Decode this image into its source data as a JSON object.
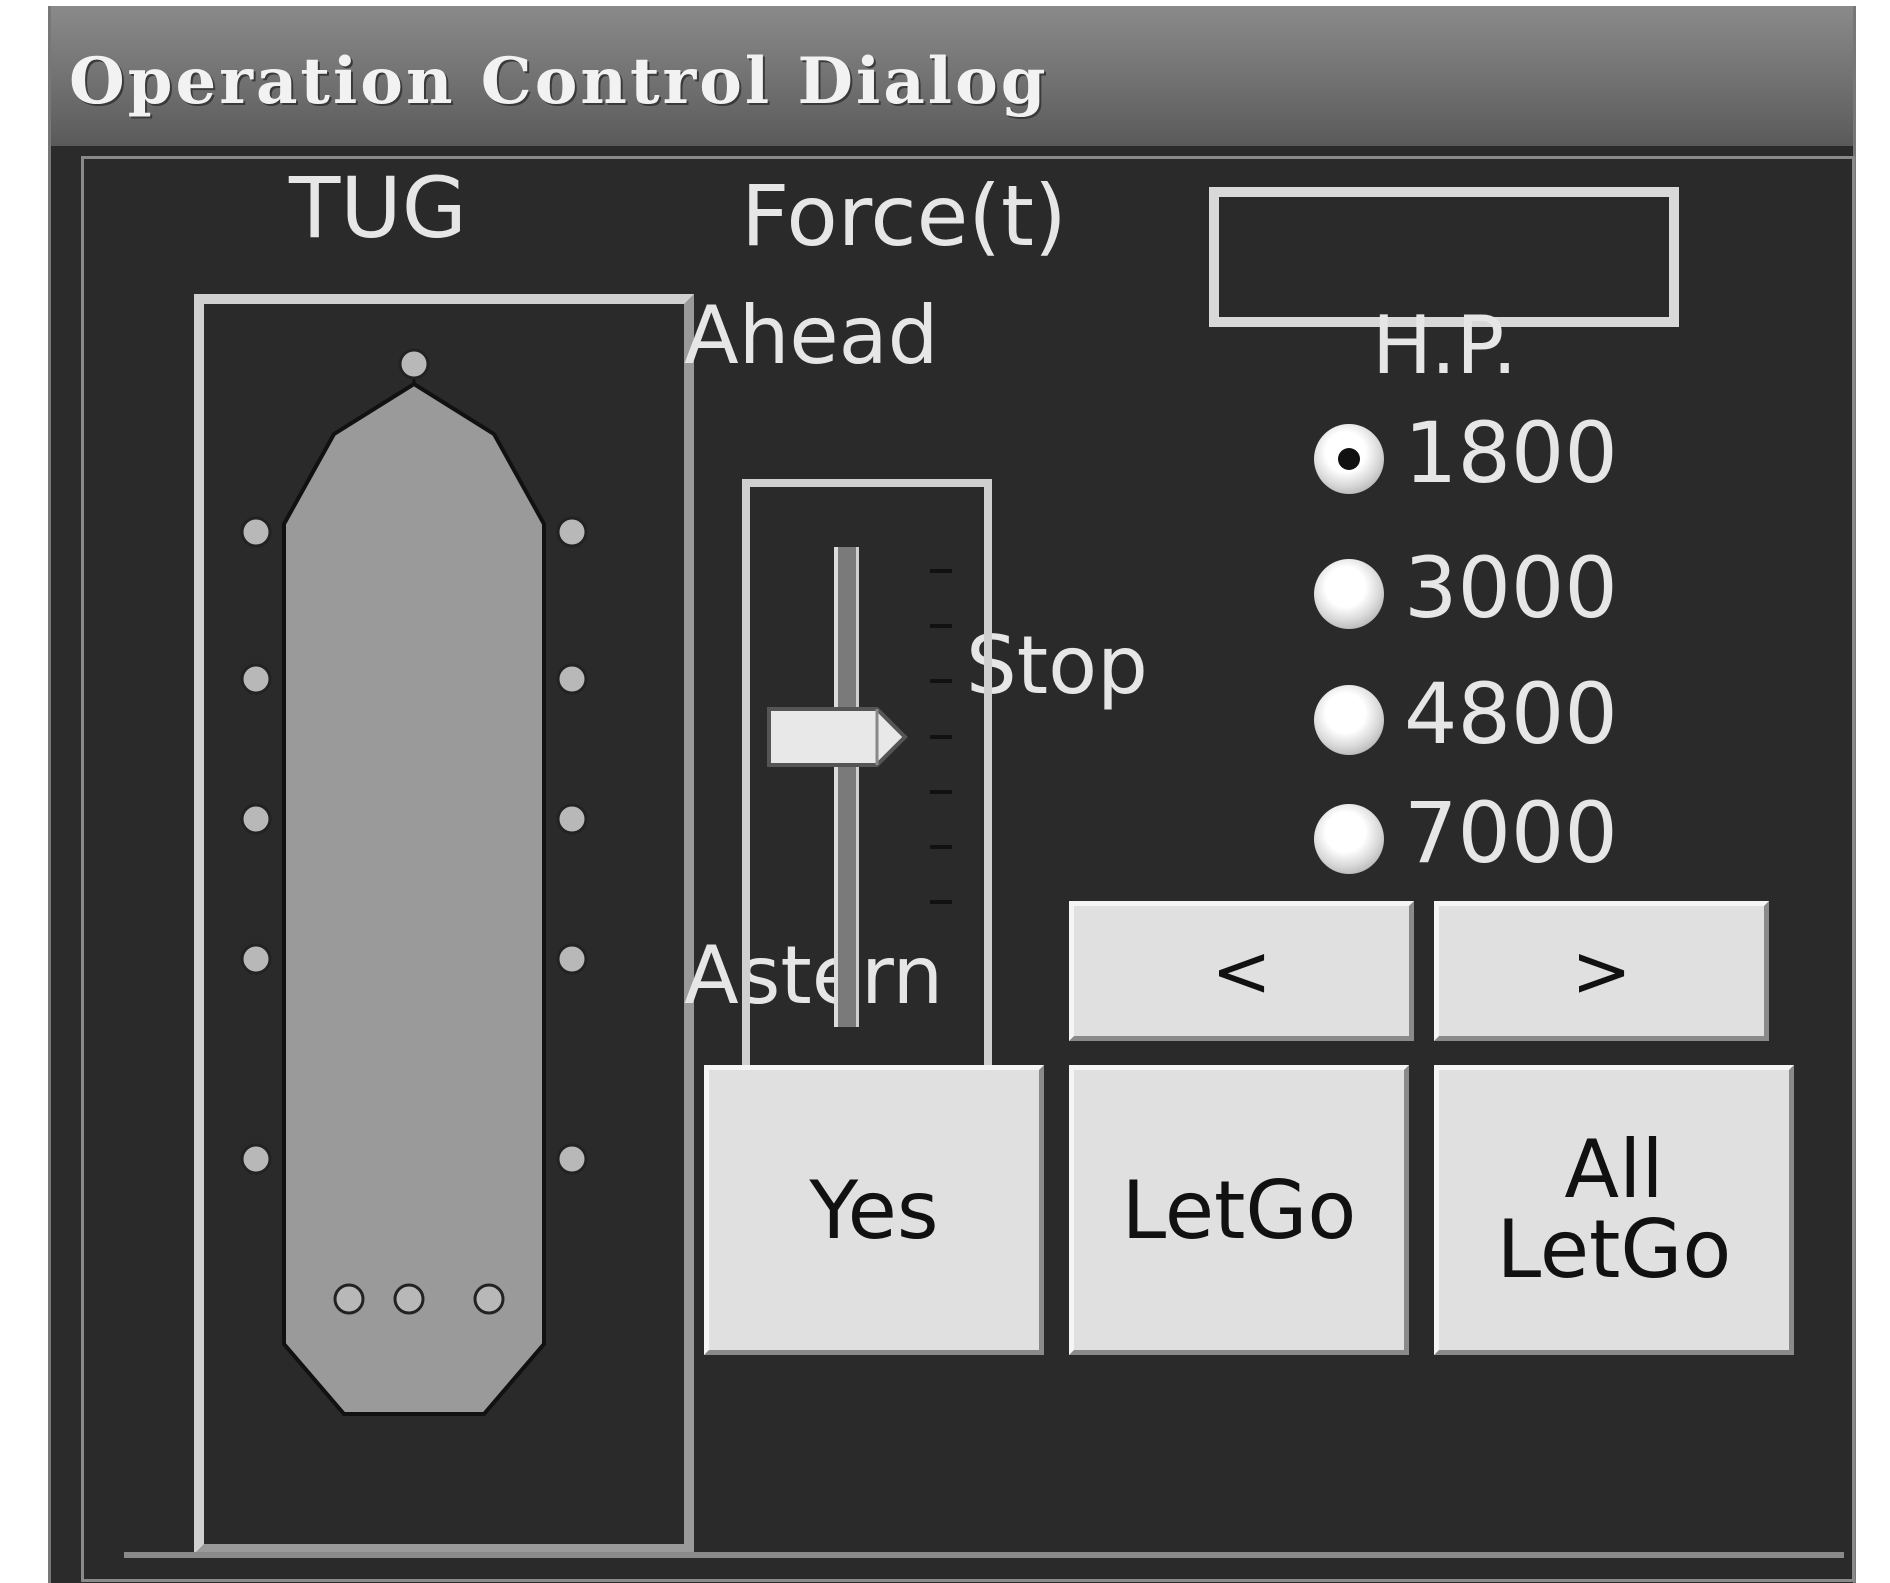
{
  "window": {
    "title": "Operation Control Dialog"
  },
  "tug_panel": {
    "label": "TUG",
    "selected_hp": "1800"
  },
  "force": {
    "label": "Force(t)",
    "value": ""
  },
  "throttle": {
    "ahead_label": "Ahead",
    "stop_label": "Stop",
    "astern_label": "Astern",
    "position": "Stop"
  },
  "horsepower": {
    "label": "H.P.",
    "options": [
      "1800",
      "3000",
      "4800",
      "7000"
    ]
  },
  "buttons": {
    "prev": "<",
    "next": ">",
    "yes": "Yes",
    "letgo": "LetGo",
    "all_letgo_line1": "All",
    "all_letgo_line2": "LetGo"
  },
  "colors": {
    "background": "#2a2a2a",
    "hull_fill": "#9a9a9a",
    "button_face": "#e0e0e0",
    "label_text": "#e6e6e6"
  }
}
